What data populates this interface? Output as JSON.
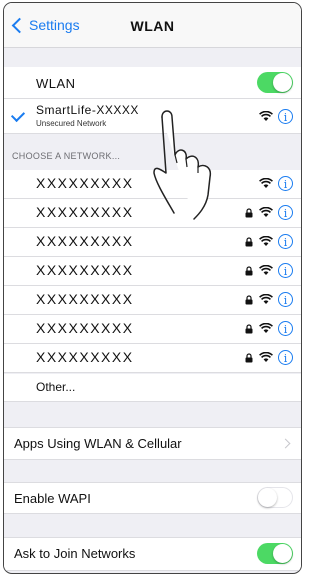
{
  "nav": {
    "back_label": "Settings",
    "title": "WLAN"
  },
  "wlan_row": {
    "label": "WLAN",
    "toggle_on": true
  },
  "connected": {
    "name": "SmartLife-XXXXX",
    "status": "Unsecured Network"
  },
  "section_header": "CHOOSE A NETWORK...",
  "networks": [
    {
      "name": "XXXXXXXXX",
      "locked": false
    },
    {
      "name": "XXXXXXXXX",
      "locked": true
    },
    {
      "name": "XXXXXXXXX",
      "locked": true
    },
    {
      "name": "XXXXXXXXX",
      "locked": true
    },
    {
      "name": "XXXXXXXXX",
      "locked": true
    },
    {
      "name": "XXXXXXXXX",
      "locked": true
    },
    {
      "name": "XXXXXXXXX",
      "locked": true
    }
  ],
  "other_label": "Other...",
  "apps_row": {
    "label": "Apps Using WLAN & Cellular"
  },
  "wapi_row": {
    "label": "Enable WAPI",
    "toggle_on": false
  },
  "ask_row": {
    "label": "Ask to Join Networks",
    "toggle_on": true
  },
  "icons": {
    "info": "i",
    "accent": "#1a7cf0",
    "toggle_on_color": "#4cd964"
  }
}
